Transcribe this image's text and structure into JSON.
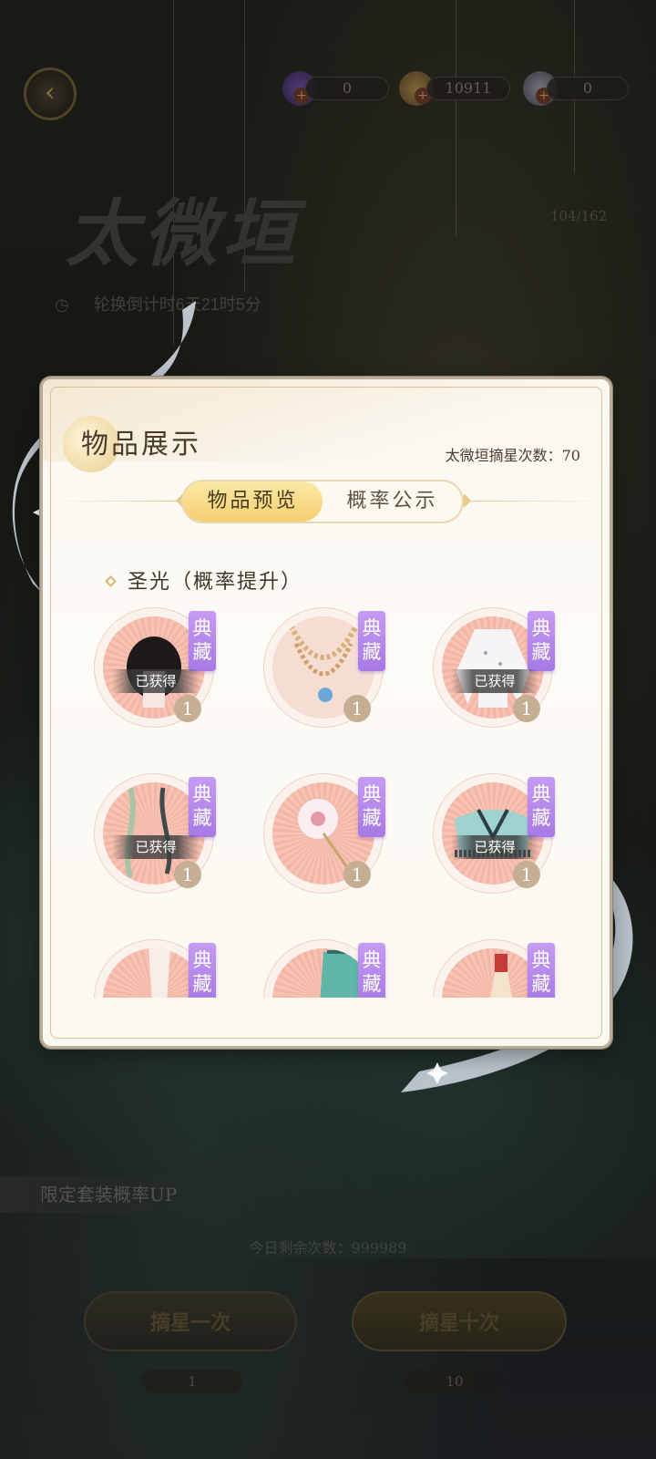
{
  "currencies": [
    {
      "icon": "purple-gem-icon",
      "value": "0"
    },
    {
      "icon": "gold-coin-icon",
      "value": "10911"
    },
    {
      "icon": "pearl-icon",
      "value": "0"
    }
  ],
  "banner": {
    "title": "太微垣",
    "countdown": "轮换倒计时6天21时5分",
    "progress": "104/162"
  },
  "bottom": {
    "up_text": "限定套装概率UP",
    "remaining": "今日剩余次数：999989",
    "draw_once": "摘星一次",
    "draw_ten": "摘星十次",
    "cost_once": "1",
    "cost_ten": "10"
  },
  "modal": {
    "title": "物品展示",
    "draw_count": "太微垣摘星次数：70",
    "tabs": [
      {
        "label": "物品预览",
        "active": true
      },
      {
        "label": "概率公示",
        "active": false
      }
    ],
    "section_title": "圣光（概率提升）",
    "badge_text": "典藏",
    "items": [
      {
        "icon": "black-hair-icon",
        "obtained": "已获得",
        "qty": "1"
      },
      {
        "icon": "pearl-necklace-icon",
        "obtained": "",
        "qty": "1"
      },
      {
        "icon": "white-top-icon",
        "obtained": "已获得",
        "qty": "1"
      },
      {
        "icon": "ribbon-accessory-icon",
        "obtained": "已获得",
        "qty": "1"
      },
      {
        "icon": "flower-hairpin-icon",
        "obtained": "",
        "qty": "1"
      },
      {
        "icon": "teal-top-icon",
        "obtained": "已获得",
        "qty": "1"
      },
      {
        "icon": "stockings-icon",
        "obtained": "",
        "qty": ""
      },
      {
        "icon": "teal-skirt-icon",
        "obtained": "",
        "qty": ""
      },
      {
        "icon": "red-ornament-icon",
        "obtained": "",
        "qty": ""
      }
    ]
  },
  "colors": {
    "badge_purple": "#a679e4",
    "tab_active": "#f4cf6f",
    "circle_pink": "#f3b5a4"
  }
}
